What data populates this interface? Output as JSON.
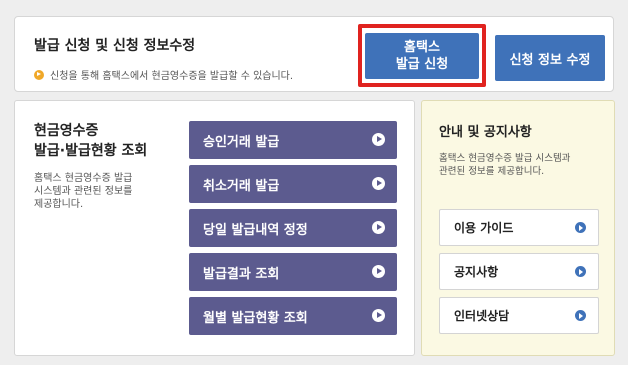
{
  "top": {
    "title": "발급 신청 및 신청 정보수정",
    "description": "신청을 통해 홈택스에서 현금영수증을 발급할 수 있습니다.",
    "issue_button": {
      "line1": "홈택스",
      "line2": "발급 신청"
    },
    "edit_button": "신청 정보 수정",
    "highlight_color": "#e0231f"
  },
  "left": {
    "title_line1": "현금영수증",
    "title_line2": "발급·발급현황 조회",
    "desc_line1": "홈택스 현금영수증 발급",
    "desc_line2": "시스템과 관련된 정보를",
    "desc_line3": "제공합니다.",
    "buttons": [
      {
        "label": "승인거래 발급"
      },
      {
        "label": "취소거래 발급"
      },
      {
        "label": "당일 발급내역 정정"
      },
      {
        "label": "발급결과 조회"
      },
      {
        "label": "월별 발급현황 조회"
      }
    ]
  },
  "right": {
    "title": "안내 및 공지사항",
    "desc_line1": "홈택스 현금영수증 발급 시스템과",
    "desc_line2": "관련된 정보를 제공합니다.",
    "buttons": [
      {
        "label": "이용 가이드"
      },
      {
        "label": "공지사항"
      },
      {
        "label": "인터넷상담"
      }
    ]
  },
  "colors": {
    "blue_button": "#3f72b9",
    "purple_button": "#5c5b8f",
    "notice_background": "#fbf9e3",
    "bullet": "#f0a828"
  }
}
